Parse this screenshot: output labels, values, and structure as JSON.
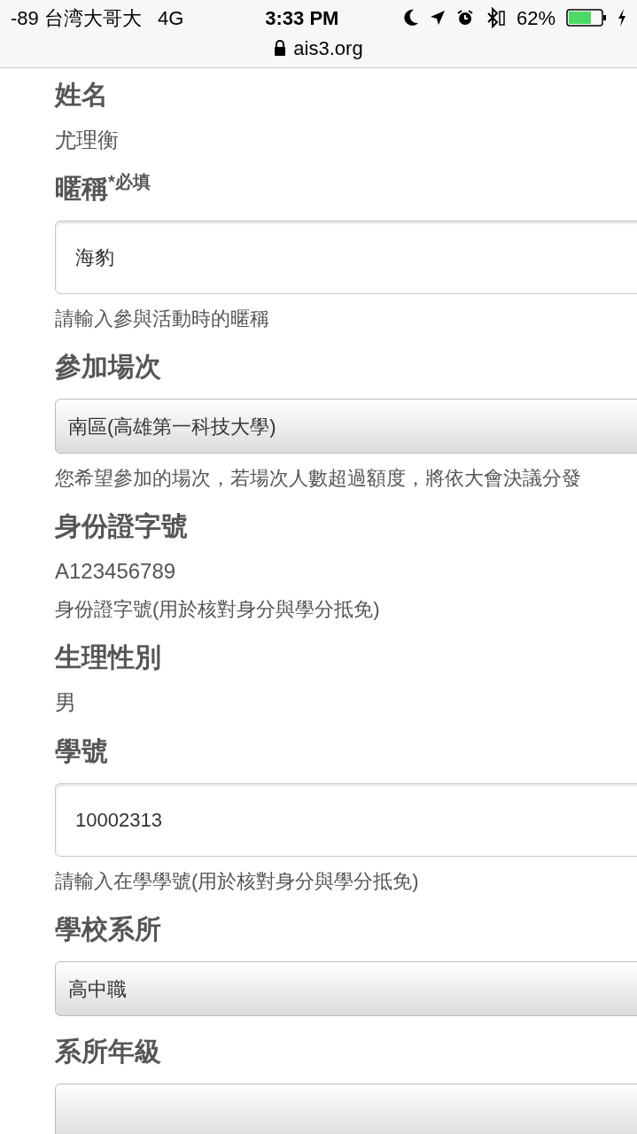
{
  "status_bar": {
    "carrier": "-89 台湾大哥大",
    "network": "4G",
    "time": "3:33 PM",
    "battery_percent": "62%",
    "charging": true
  },
  "address_bar": {
    "url": "ais3.org",
    "secure": true
  },
  "fields": [
    {
      "kind": "static",
      "label": "姓名",
      "value": "尤理衡"
    },
    {
      "kind": "input",
      "label": "暱稱",
      "required_mark": "*必填",
      "value": "海豹",
      "help": "請輸入參與活動時的暱稱"
    },
    {
      "kind": "select",
      "label": "參加場次",
      "value": "南區(高雄第一科技大學)",
      "help": "您希望參加的場次，若場次人數超過額度，將依大會決議分發"
    },
    {
      "kind": "static",
      "label": "身份證字號",
      "value": "A123456789",
      "help": "身份證字號(用於核對身分與學分抵免)"
    },
    {
      "kind": "static",
      "label": "生理性別",
      "value": "男"
    },
    {
      "kind": "input",
      "label": "學號",
      "value": "10002313",
      "help": "請輸入在學學號(用於核對身分與學分抵免)"
    },
    {
      "kind": "select",
      "label": "學校系所",
      "value": "高中職"
    },
    {
      "kind": "select",
      "label": "系所年級"
    }
  ]
}
